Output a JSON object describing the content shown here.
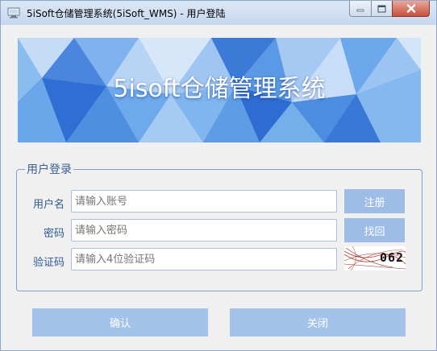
{
  "window": {
    "title": "5iSoft仓储管理系统(5iSoft_WMS) - 用户登陆"
  },
  "banner": {
    "title": "5isoft仓储管理系统"
  },
  "login_group": {
    "legend": "用户登录",
    "username": {
      "label": "用户名",
      "placeholder": "请输入账号",
      "value": ""
    },
    "password": {
      "label": "密码",
      "placeholder": "请输入密码",
      "value": ""
    },
    "captcha": {
      "label": "验证码",
      "placeholder": "请输入4位验证码",
      "value": ""
    },
    "register_label": "注册",
    "recover_label": "找回",
    "captcha_image_text": "062"
  },
  "actions": {
    "confirm_label": "确认",
    "close_label": "关闭"
  },
  "colors": {
    "accent": "#2f5a90",
    "button_bg": "#a4c3ea",
    "banner_base": "#5b9be6"
  }
}
